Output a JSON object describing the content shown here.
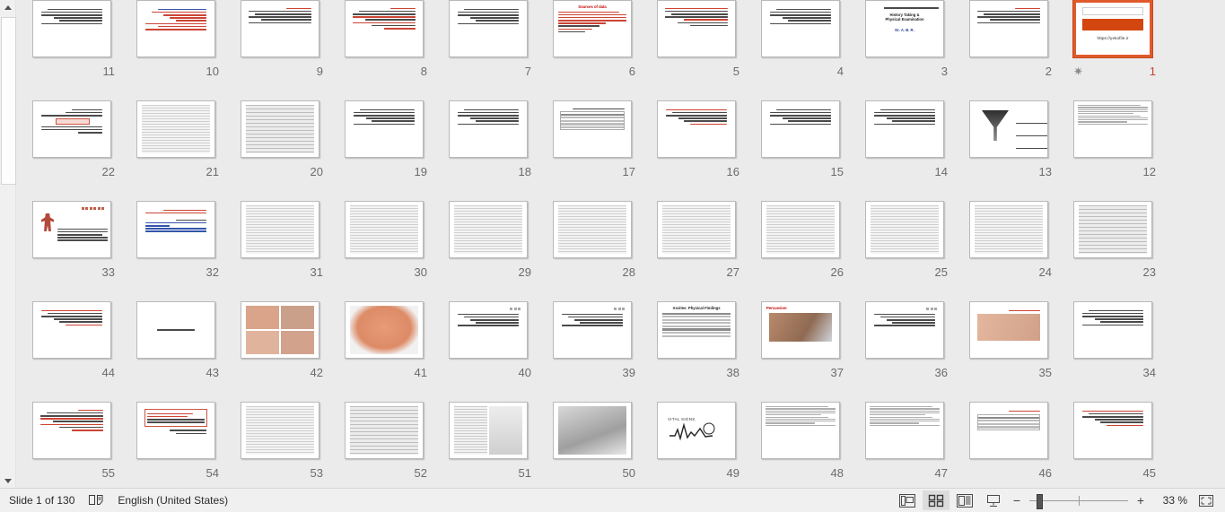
{
  "window": {
    "view_name": "Slide Sorter",
    "background_color": "#ebebeb"
  },
  "scrollbar": {
    "name": "vertical-scrollbar",
    "up_arrow": "▲",
    "down_arrow": "▼"
  },
  "status_bar": {
    "slide_indicator": "Slide 1 of 130",
    "language": "English (United States)",
    "notes_icon": "notes-icon",
    "zoom_percent": "33 %",
    "zoom_minus": "−",
    "zoom_plus": "+",
    "views": [
      {
        "name": "normal-view",
        "label": "Normal",
        "active": false
      },
      {
        "name": "slide-sorter-view",
        "label": "Slide Sorter",
        "active": true
      },
      {
        "name": "reading-view",
        "label": "Reading View",
        "active": false
      },
      {
        "name": "slide-show-view",
        "label": "Slide Show",
        "active": false
      }
    ],
    "fit_button": "Fit slide to current window"
  },
  "slide_grid": {
    "columns": 11,
    "rows": 5,
    "selected_slide": 1,
    "slides": [
      {
        "number": "11",
        "kind": "text-rtl",
        "selected": false,
        "animated": false
      },
      {
        "number": "10",
        "kind": "bullets-red",
        "selected": false,
        "animated": false
      },
      {
        "number": "9",
        "kind": "text-rtl-title",
        "selected": false,
        "animated": false
      },
      {
        "number": "8",
        "kind": "text-red-mixed",
        "selected": false,
        "animated": false
      },
      {
        "number": "7",
        "kind": "text-rtl",
        "selected": false,
        "animated": false
      },
      {
        "number": "6",
        "kind": "sources-of-data",
        "title": "Sources of data",
        "selected": false,
        "animated": false
      },
      {
        "number": "5",
        "kind": "text-red-title",
        "selected": false,
        "animated": false
      },
      {
        "number": "4",
        "kind": "text-rtl",
        "selected": false,
        "animated": false
      },
      {
        "number": "3",
        "kind": "history-taking",
        "title": "History Taking &\nPhysical Examination",
        "selected": false,
        "animated": false
      },
      {
        "number": "2",
        "kind": "text-rtl-title",
        "selected": false,
        "animated": false
      },
      {
        "number": "1",
        "kind": "title-banner",
        "url": "https://yekofile.ir",
        "selected": true,
        "animated": true
      },
      {
        "number": "22",
        "kind": "text-redbox",
        "selected": false,
        "animated": false
      },
      {
        "number": "21",
        "kind": "scan-page",
        "selected": false,
        "animated": false
      },
      {
        "number": "20",
        "kind": "scan-dense",
        "selected": false,
        "animated": false
      },
      {
        "number": "19",
        "kind": "text-rtl",
        "selected": false,
        "animated": false
      },
      {
        "number": "18",
        "kind": "text-rtl",
        "selected": false,
        "animated": false
      },
      {
        "number": "17",
        "kind": "table-scan",
        "selected": false,
        "animated": false
      },
      {
        "number": "16",
        "kind": "red-heading",
        "selected": false,
        "animated": false
      },
      {
        "number": "15",
        "kind": "text-rtl",
        "selected": false,
        "animated": false
      },
      {
        "number": "14",
        "kind": "text-rtl",
        "selected": false,
        "animated": false
      },
      {
        "number": "13",
        "kind": "funnel-diagram",
        "selected": false,
        "animated": false
      },
      {
        "number": "12",
        "kind": "text-dense",
        "selected": false,
        "animated": false
      },
      {
        "number": "33",
        "kind": "figure-slide",
        "selected": false,
        "animated": false
      },
      {
        "number": "32",
        "kind": "bullets-list",
        "selected": false,
        "animated": false
      },
      {
        "number": "31",
        "kind": "scan-page",
        "selected": false,
        "animated": false
      },
      {
        "number": "30",
        "kind": "scan-page",
        "selected": false,
        "animated": false
      },
      {
        "number": "29",
        "kind": "scan-page",
        "selected": false,
        "animated": false
      },
      {
        "number": "28",
        "kind": "scan-page",
        "selected": false,
        "animated": false
      },
      {
        "number": "27",
        "kind": "scan-page",
        "selected": false,
        "animated": false
      },
      {
        "number": "26",
        "kind": "scan-page",
        "selected": false,
        "animated": false
      },
      {
        "number": "25",
        "kind": "scan-page",
        "selected": false,
        "animated": false
      },
      {
        "number": "24",
        "kind": "scan-page",
        "selected": false,
        "animated": false
      },
      {
        "number": "23",
        "kind": "scan-dense",
        "selected": false,
        "animated": false
      },
      {
        "number": "44",
        "kind": "red-heading",
        "selected": false,
        "animated": false
      },
      {
        "number": "43",
        "kind": "centered-rtl-line",
        "selected": false,
        "animated": false
      },
      {
        "number": "42",
        "kind": "photo-quad",
        "selected": false,
        "animated": false
      },
      {
        "number": "41",
        "kind": "anatomy-photo",
        "selected": false,
        "animated": false
      },
      {
        "number": "40",
        "kind": "text-dots",
        "selected": false,
        "animated": false
      },
      {
        "number": "39",
        "kind": "text-dots",
        "selected": false,
        "animated": false
      },
      {
        "number": "38",
        "kind": "ascites-table",
        "title": "Ascites: Physical Findings",
        "selected": false,
        "animated": false
      },
      {
        "number": "37",
        "kind": "percussion-photo",
        "title": "Percussion",
        "selected": false,
        "animated": false
      },
      {
        "number": "36",
        "kind": "text-dots",
        "selected": false,
        "animated": false
      },
      {
        "number": "35",
        "kind": "hands-photo",
        "selected": false,
        "animated": false
      },
      {
        "number": "34",
        "kind": "text-rtl",
        "selected": false,
        "animated": false
      },
      {
        "number": "55",
        "kind": "text-red-mixed",
        "selected": false,
        "animated": false
      },
      {
        "number": "54",
        "kind": "boxed-red-text",
        "selected": false,
        "animated": false
      },
      {
        "number": "53",
        "kind": "scan-page",
        "selected": false,
        "animated": false
      },
      {
        "number": "52",
        "kind": "scan-dense",
        "selected": false,
        "animated": false
      },
      {
        "number": "51",
        "kind": "scan-figure",
        "selected": false,
        "animated": false
      },
      {
        "number": "50",
        "kind": "scan-photo",
        "selected": false,
        "animated": false
      },
      {
        "number": "49",
        "kind": "vital-signs",
        "title": "VITAL SIGNS",
        "selected": false,
        "animated": false
      },
      {
        "number": "48",
        "kind": "text-dense",
        "selected": false,
        "animated": false
      },
      {
        "number": "47",
        "kind": "text-dense",
        "selected": false,
        "animated": false
      },
      {
        "number": "46",
        "kind": "table-slide",
        "selected": false,
        "animated": false
      },
      {
        "number": "45",
        "kind": "red-heading",
        "selected": false,
        "animated": false
      }
    ]
  }
}
